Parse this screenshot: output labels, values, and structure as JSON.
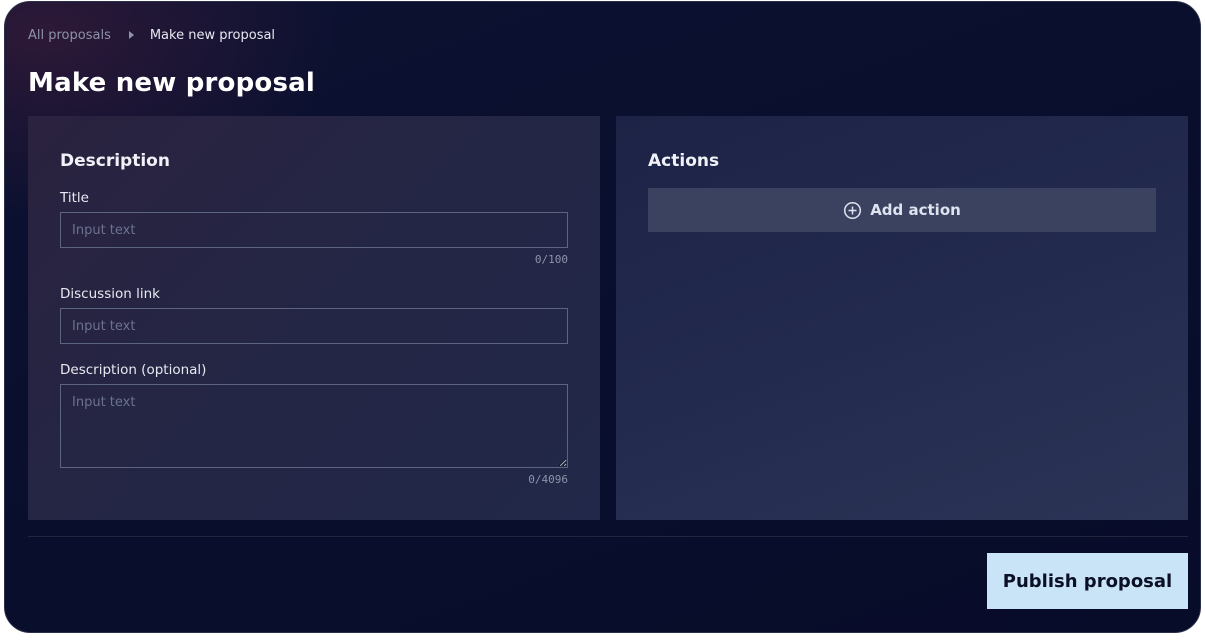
{
  "breadcrumb": {
    "parent": "All proposals",
    "current": "Make new proposal"
  },
  "page": {
    "title": "Make new proposal"
  },
  "description_panel": {
    "heading": "Description",
    "title_field": {
      "label": "Title",
      "value": "",
      "placeholder": "Input text",
      "counter": "0/100"
    },
    "discussion_field": {
      "label": "Discussion link",
      "value": "",
      "placeholder": "Input text"
    },
    "description_field": {
      "label": "Description (optional)",
      "value": "",
      "placeholder": "Input text",
      "counter": "0/4096"
    }
  },
  "actions_panel": {
    "heading": "Actions",
    "add_action_label": "Add action",
    "add_action_icon": "plus-circle-icon"
  },
  "footer": {
    "publish_label": "Publish proposal"
  },
  "colors": {
    "background": "#070c29",
    "panel": "#252544",
    "add_action_bg": "#3a4260",
    "primary_button": "#c9e4f6"
  }
}
